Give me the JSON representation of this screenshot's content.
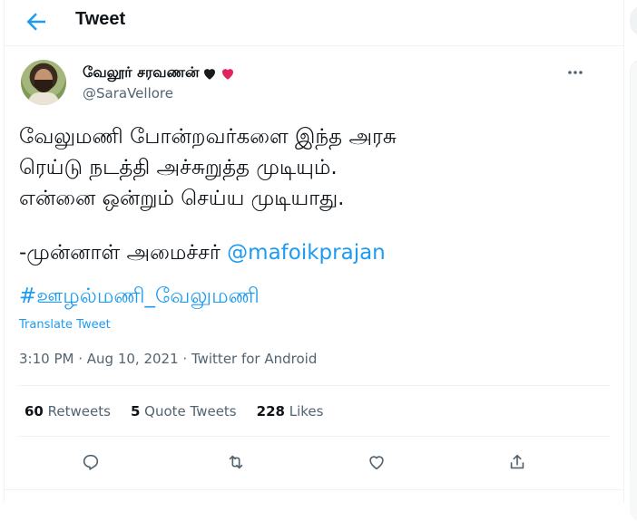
{
  "header": {
    "title": "Tweet"
  },
  "author": {
    "display_name": "வேலூர் சரவணன்",
    "handle": "@SaraVellore"
  },
  "tweet": {
    "lines": [
      "வேலுமணி போன்றவர்களை இந்த அரசு",
      "ரெய்டு நடத்தி அச்சுறுத்த முடியும்.",
      "என்னை ஒன்றும் செய்ய முடியாது."
    ],
    "quote_prefix": "-முன்னாள் அமைச்சர் ",
    "mention": "@mafoikprajan",
    "hashtag": "#ஊழல்மணி_வேலுமணி"
  },
  "translate_label": "Translate Tweet",
  "meta": {
    "time": "3:10 PM",
    "sep1": " · ",
    "date": "Aug 10, 2021",
    "sep2": " · ",
    "source": "Twitter for Android"
  },
  "stats": {
    "retweets": {
      "count": "60",
      "label": "Retweets"
    },
    "quotes": {
      "count": "5",
      "label": "Quote Tweets"
    },
    "likes": {
      "count": "228",
      "label": "Likes"
    }
  },
  "icons": {
    "back": "back-arrow-icon",
    "more": "more-icon",
    "reply": "reply-icon",
    "retweet": "retweet-icon",
    "like": "like-icon",
    "share": "share-icon",
    "black_heart": "black-heart-icon",
    "red_heart": "red-heart-icon"
  },
  "colors": {
    "accent": "#1d9bf0",
    "secondary_text": "#536471",
    "primary_text": "#0f1419",
    "divider": "#eff3f4",
    "red_heart": "#e0245e"
  }
}
